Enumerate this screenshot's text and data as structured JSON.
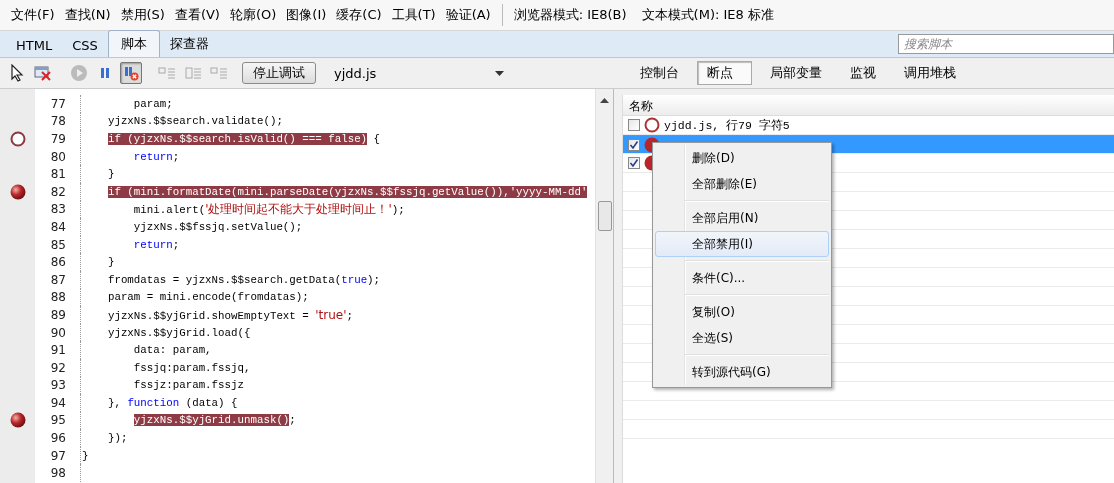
{
  "menu_bar": {
    "items": [
      "文件(F)",
      "查找(N)",
      "禁用(S)",
      "查看(V)",
      "轮廓(O)",
      "图像(I)",
      "缓存(C)",
      "工具(T)",
      "验证(A)"
    ],
    "modes": [
      "浏览器模式: IE8(B)",
      "文本模式(M): IE8 标准"
    ]
  },
  "tabs": [
    {
      "label": "HTML",
      "selected": false
    },
    {
      "label": "CSS",
      "selected": false
    },
    {
      "label": "脚本",
      "selected": true
    },
    {
      "label": "探查器",
      "selected": false
    }
  ],
  "search": {
    "placeholder": "搜索脚本"
  },
  "toolbar": {
    "break_on_error": {
      "on": true
    },
    "stop_button": "停止调试",
    "file": "yjdd.js"
  },
  "panel_tabs": [
    {
      "label": "控制台",
      "selected": false
    },
    {
      "label": "断点",
      "selected": true
    },
    {
      "label": "局部变量",
      "selected": false
    },
    {
      "label": "监视",
      "selected": false
    },
    {
      "label": "调用堆栈",
      "selected": false
    }
  ],
  "code": [
    {
      "number": "77",
      "breakpoint": false,
      "segments": [
        {
          "text": "        param;",
          "highlight": false
        }
      ]
    },
    {
      "number": "78",
      "breakpoint": false,
      "segments": [
        {
          "text": "    yjzxNs.$$search.validate();",
          "highlight": false
        }
      ]
    },
    {
      "number": "79",
      "breakpoint": true,
      "enabled": false,
      "segments": [
        {
          "text": "    if (yjzxNs.$$search.isValid() === false)",
          "highlight": true
        },
        {
          "text": " {",
          "highlight": false
        }
      ]
    },
    {
      "number": "80",
      "breakpoint": false,
      "segments": [
        {
          "text": "        return",
          "kind": "keyword",
          "highlight": false
        },
        {
          "text": ";",
          "highlight": false
        }
      ]
    },
    {
      "number": "81",
      "breakpoint": false,
      "segments": [
        {
          "text": "    }",
          "highlight": false
        }
      ]
    },
    {
      "number": "82",
      "breakpoint": true,
      "enabled": true,
      "segments": [
        {
          "text": "    if (mini.formatDate(mini.parseDate(yjzxNs.$$fssjq.getValue()),'yyyy-MM-dd'",
          "highlight": true
        }
      ]
    },
    {
      "number": "83",
      "breakpoint": false,
      "segments": [
        {
          "text": "        mini.alert(",
          "highlight": false
        },
        {
          "text": "'处理时间起不能大于处理时间止！'",
          "kind": "string",
          "highlight": false
        },
        {
          "text": ");",
          "highlight": false
        }
      ]
    },
    {
      "number": "84",
      "breakpoint": false,
      "segments": [
        {
          "text": "        yjzxNs.$$fssjq.setValue();",
          "highlight": false
        }
      ]
    },
    {
      "number": "85",
      "breakpoint": false,
      "segments": [
        {
          "text": "        return",
          "kind": "keyword",
          "highlight": false
        },
        {
          "text": ";",
          "highlight": false
        }
      ]
    },
    {
      "number": "86",
      "breakpoint": false,
      "segments": [
        {
          "text": "    }",
          "highlight": false
        }
      ]
    },
    {
      "number": "87",
      "breakpoint": false,
      "segments": [
        {
          "text": "    fromdatas = yjzxNs.$$search.getData(",
          "highlight": false
        },
        {
          "text": "true",
          "kind": "keyword",
          "highlight": false
        },
        {
          "text": ");",
          "highlight": false
        }
      ]
    },
    {
      "number": "88",
      "breakpoint": false,
      "segments": [
        {
          "text": "    param = mini.encode(fromdatas);",
          "highlight": false
        }
      ]
    },
    {
      "number": "89",
      "breakpoint": false,
      "segments": [
        {
          "text": "    yjzxNs.$$yjGrid.showEmptyText = ",
          "highlight": false
        },
        {
          "text": "'true'",
          "kind": "string",
          "highlight": false
        },
        {
          "text": ";",
          "highlight": false
        }
      ]
    },
    {
      "number": "90",
      "breakpoint": false,
      "segments": [
        {
          "text": "    yjzxNs.$$yjGrid.load({",
          "highlight": false
        }
      ]
    },
    {
      "number": "91",
      "breakpoint": false,
      "segments": [
        {
          "text": "        data: param,",
          "highlight": false
        }
      ]
    },
    {
      "number": "92",
      "breakpoint": false,
      "segments": [
        {
          "text": "        fssjq:param.fssjq,",
          "highlight": false
        }
      ]
    },
    {
      "number": "93",
      "breakpoint": false,
      "segments": [
        {
          "text": "        fssjz:param.fssjz",
          "highlight": false
        }
      ]
    },
    {
      "number": "94",
      "breakpoint": false,
      "segments": [
        {
          "text": "    }, ",
          "highlight": false
        },
        {
          "text": "function",
          "kind": "keyword",
          "highlight": false
        },
        {
          "text": " (data) {",
          "highlight": false
        }
      ]
    },
    {
      "number": "95",
      "breakpoint": true,
      "enabled": true,
      "segments": [
        {
          "text": "        yjzxNs.$$yjGrid.unmask()",
          "highlight": true
        },
        {
          "text": ";",
          "highlight": false
        }
      ]
    },
    {
      "number": "96",
      "breakpoint": false,
      "segments": [
        {
          "text": "    });",
          "highlight": false
        }
      ]
    },
    {
      "number": "97",
      "breakpoint": false,
      "segments": [
        {
          "text": "}",
          "highlight": false
        }
      ]
    },
    {
      "number": "98",
      "breakpoint": false
    }
  ],
  "breakpoints": {
    "column": "名称",
    "rows": [
      {
        "checked": false,
        "selected": false,
        "text": "yjdd.js, 行79 字符5"
      },
      {
        "checked": true,
        "selected": true
      },
      {
        "checked": true,
        "selected": false
      }
    ]
  },
  "context_menu": {
    "groups": [
      [
        {
          "label": "删除(D)",
          "selected": false
        },
        {
          "label": "全部删除(E)",
          "selected": false
        }
      ],
      [
        {
          "label": "全部启用(N)",
          "selected": false
        },
        {
          "label": "全部禁用(I)",
          "selected": true
        }
      ],
      [
        {
          "label": "条件(C)...",
          "selected": false
        }
      ],
      [
        {
          "label": "复制(O)",
          "selected": false
        },
        {
          "label": "全选(S)",
          "selected": false
        }
      ],
      [
        {
          "label": "转到源代码(G)",
          "selected": false
        }
      ]
    ]
  }
}
